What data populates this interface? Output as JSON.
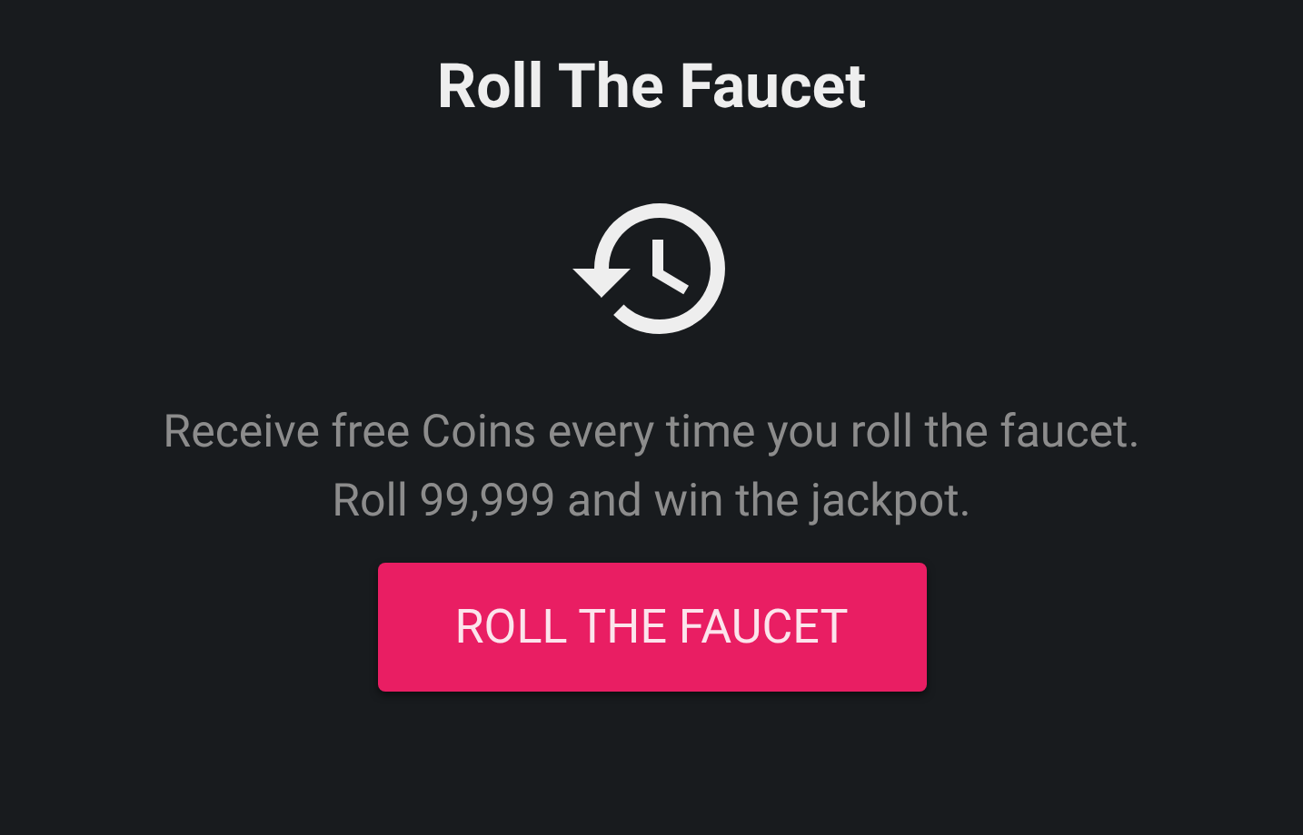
{
  "title": "Roll The Faucet",
  "description_lines": [
    "Receive free Coins every time you roll the faucet.",
    "Roll 99,999 and win the jackpot."
  ],
  "button": {
    "label": "ROLL THE FAUCET"
  }
}
